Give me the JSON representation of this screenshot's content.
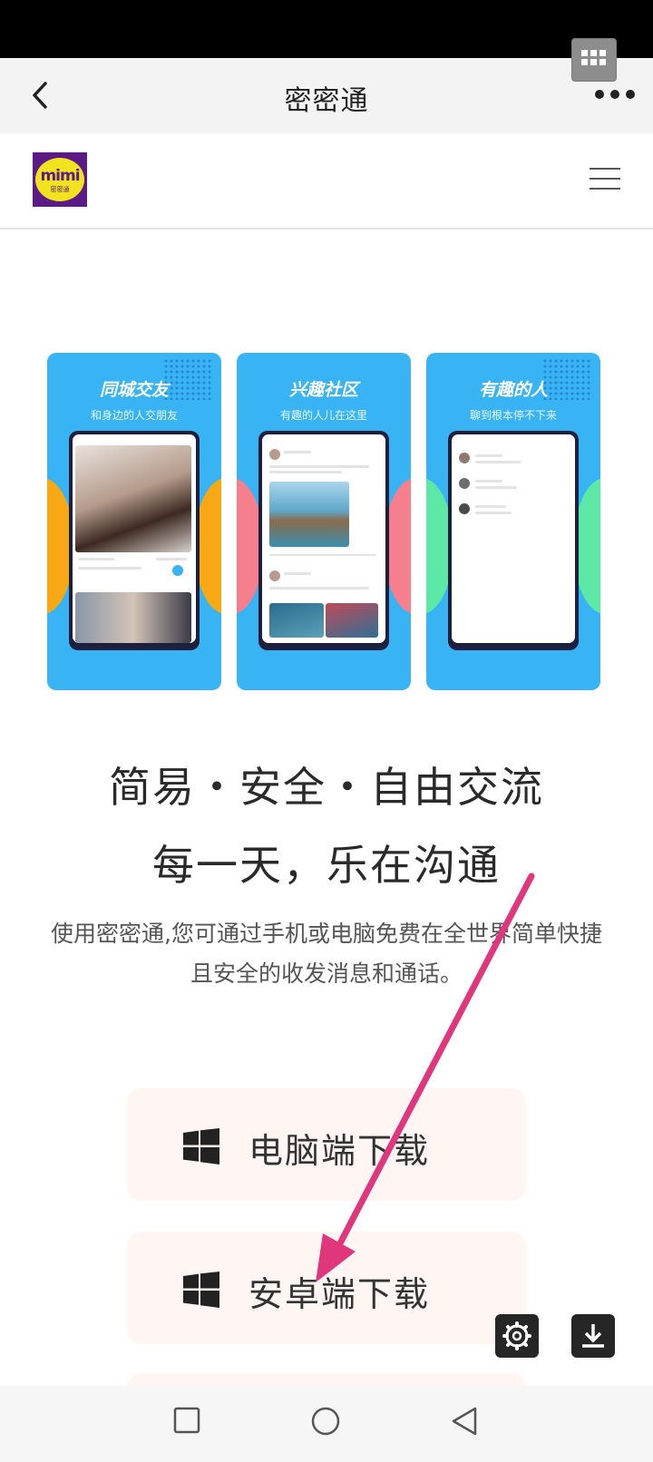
{
  "nav": {
    "title": "密密通"
  },
  "logo": {
    "text": "mimi",
    "sub": "密密通"
  },
  "screenshots": [
    {
      "title": "同城交友",
      "subtitle": "和身边的人交朋友",
      "side_color": "#f7a814"
    },
    {
      "title": "兴趣社区",
      "subtitle": "有趣的人儿在这里",
      "side_color": "#f57f8c"
    },
    {
      "title": "有趣的人",
      "subtitle": "聊到根本停不下来",
      "side_color": "#5de8a6"
    }
  ],
  "hero": {
    "slogan_line1": "简易・安全・自由交流",
    "slogan_line2": "每一天，乐在沟通",
    "description": "使用密密通,您可通过手机或电脑免费在全世界简单快捷且安全的收发消息和通话。"
  },
  "downloads": {
    "pc_label": "电脑端下载",
    "android_label": "安卓端下载"
  },
  "colors": {
    "accent_arrow": "#e0367c",
    "screenshot_bg": "#38b3f4",
    "button_bg": "#fff5f2"
  }
}
